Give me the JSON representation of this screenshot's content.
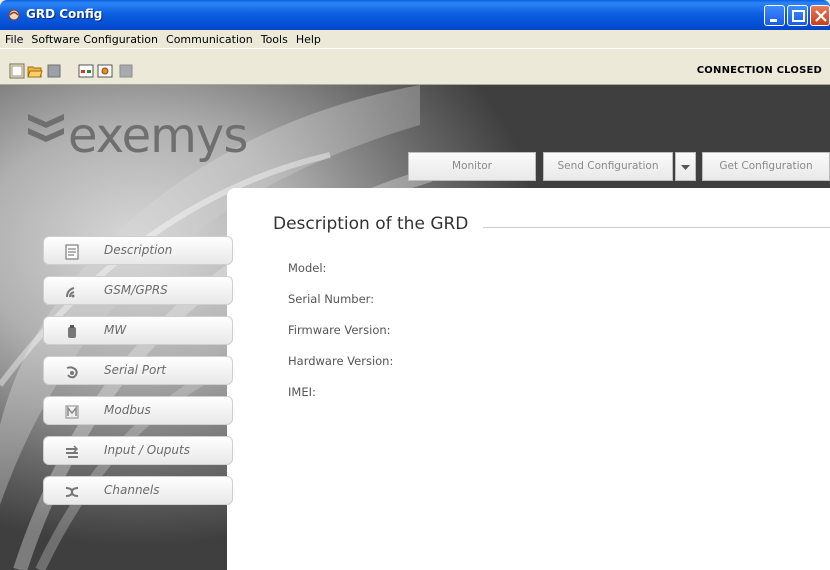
{
  "window": {
    "title": "GRD Config"
  },
  "menu": [
    "File",
    "Software Configuration",
    "Communication",
    "Tools",
    "Help"
  ],
  "toolbar": {
    "status": "CONNECTION CLOSED"
  },
  "logo": {
    "text": "exemys"
  },
  "actions": {
    "monitor": "Monitor",
    "send": "Send Configuration",
    "get": "Get Configuration"
  },
  "sidebar": [
    {
      "label": "Description",
      "icon": "document-icon"
    },
    {
      "label": "GSM/GPRS",
      "icon": "signal-icon"
    },
    {
      "label": "MW",
      "icon": "cylinder-icon"
    },
    {
      "label": "Serial Port",
      "icon": "plug-icon"
    },
    {
      "label": "Modbus",
      "icon": "modbus-icon"
    },
    {
      "label": "Input / Ouputs",
      "icon": "io-icon"
    },
    {
      "label": "Channels",
      "icon": "channels-icon"
    }
  ],
  "content": {
    "heading": "Description of the GRD",
    "fields": [
      "Model:",
      "Serial Number:",
      "Firmware Version:",
      "Hardware Version:",
      "IMEI:"
    ]
  }
}
